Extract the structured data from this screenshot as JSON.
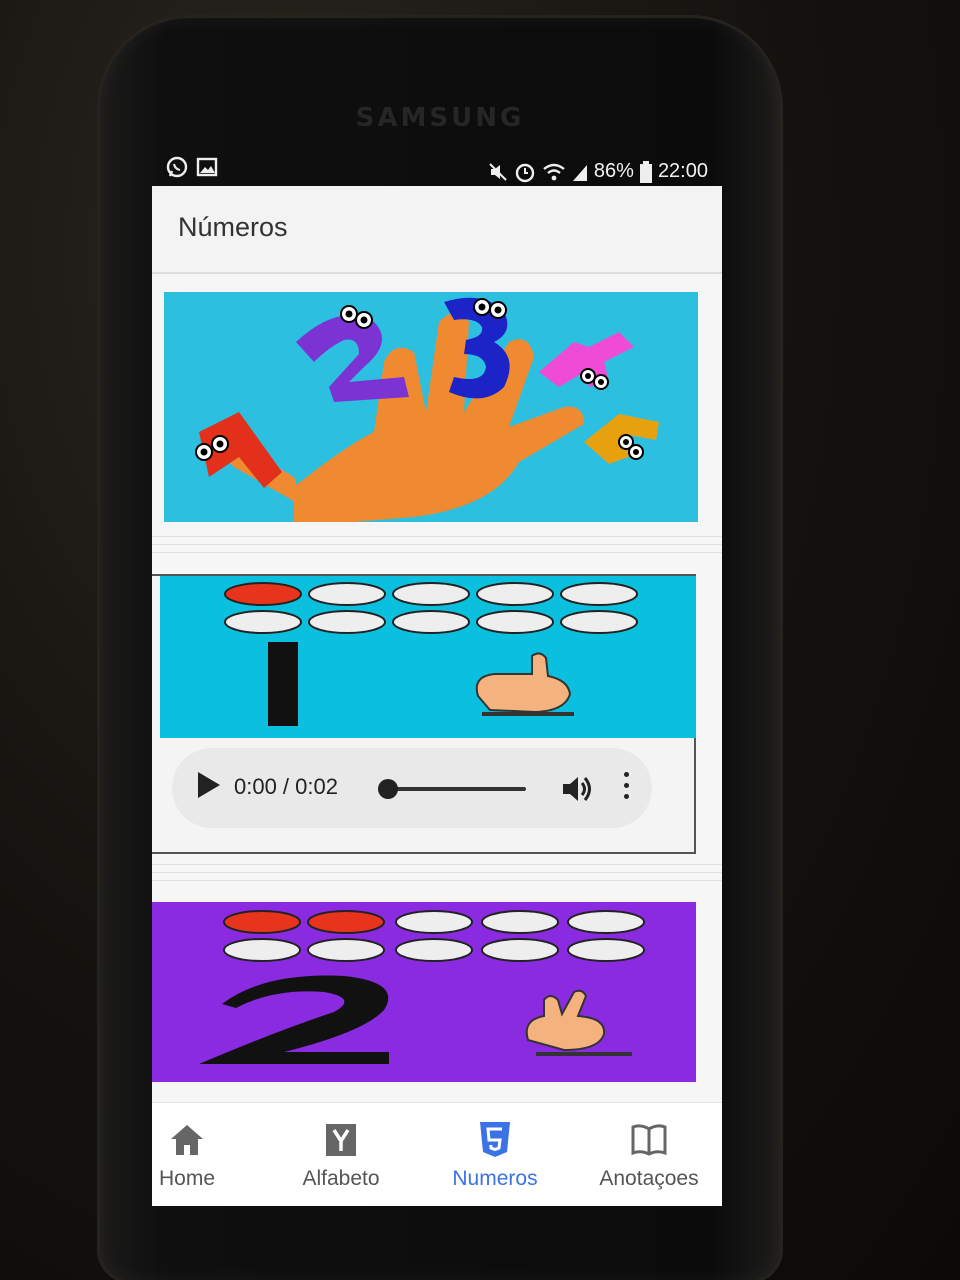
{
  "device": {
    "brand": "SAMSUNG"
  },
  "status_bar": {
    "battery": "86%",
    "time": "22:00"
  },
  "app_bar": {
    "title": "Números"
  },
  "cards": [
    {
      "kind": "banner",
      "icon": "hand-numbers-illustration",
      "bg": "#2dbfe0"
    },
    {
      "kind": "number",
      "icon": "number-one-counting-illustration",
      "bg": "#0bc0de",
      "audio": {
        "time": "0:00 / 0:02",
        "progress": 0
      }
    },
    {
      "kind": "number",
      "icon": "number-two-counting-illustration",
      "bg": "#8a2be2"
    }
  ],
  "tabs": [
    {
      "label": "Home",
      "icon": "home-icon"
    },
    {
      "label": "Alfabeto",
      "icon": "y-letter-icon"
    },
    {
      "label": "Numeros",
      "icon": "html5-icon",
      "active": true
    },
    {
      "label": "Anotaçoes",
      "icon": "book-icon"
    }
  ],
  "colors": {
    "accent": "#3b72e6",
    "filled_dot": "#e8341c"
  }
}
